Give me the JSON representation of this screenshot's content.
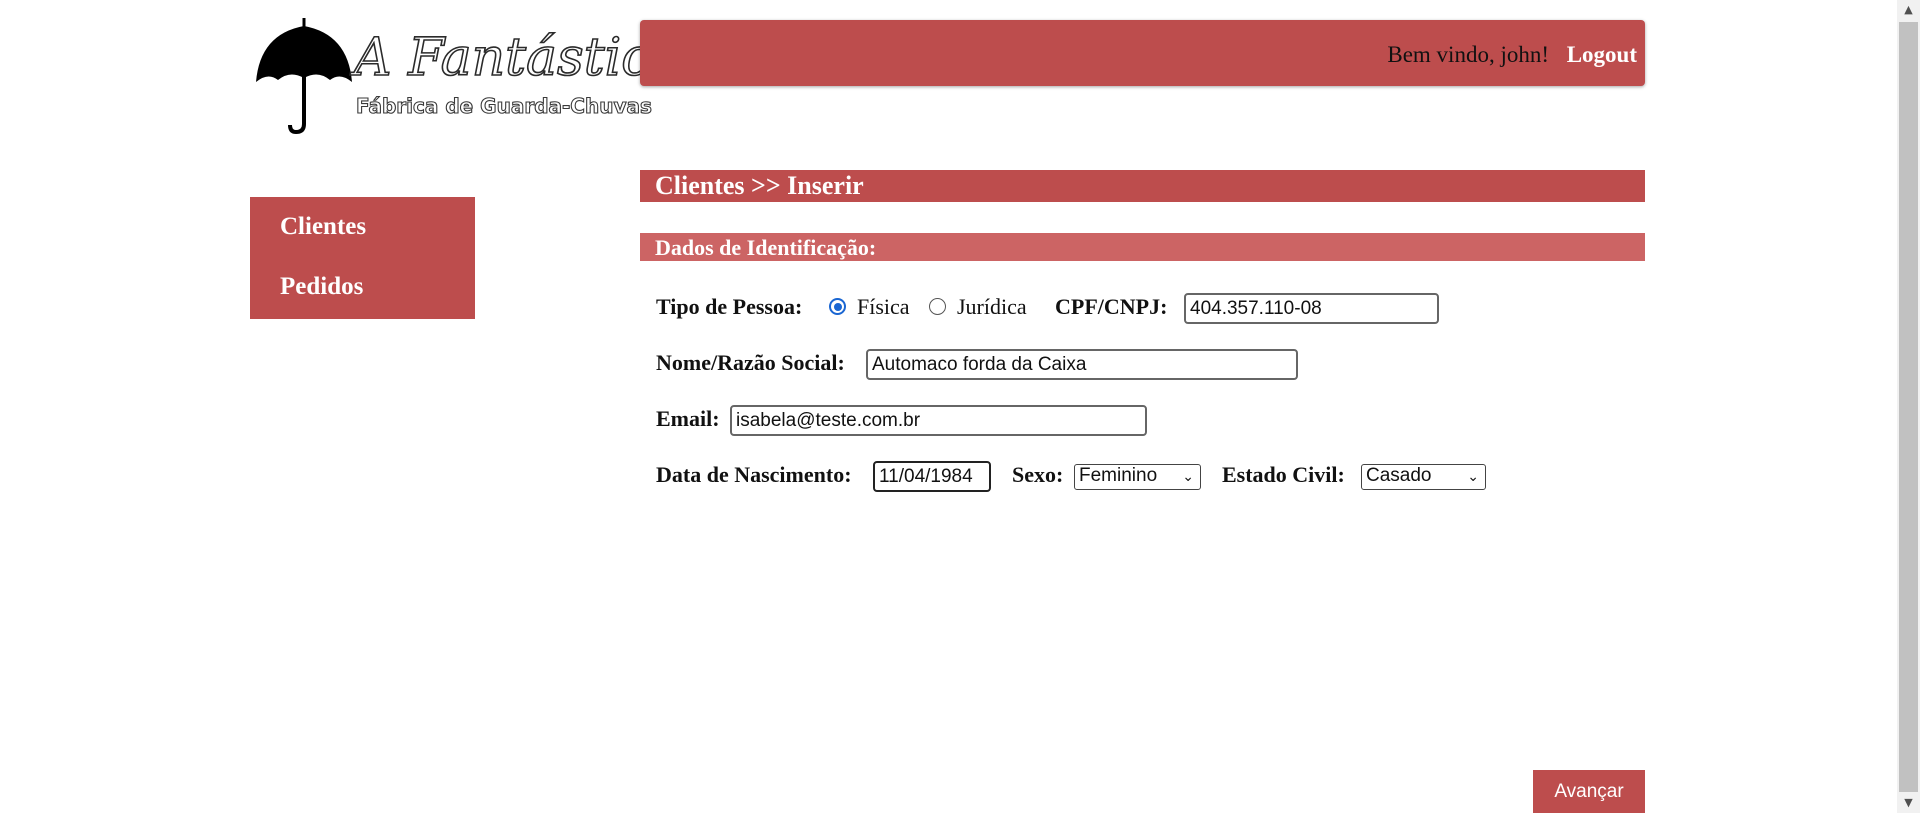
{
  "logo": {
    "title": "A Fantástica",
    "subtitle": "Fábrica de Guarda-Chuvas",
    "icon": "umbrella-icon"
  },
  "header": {
    "welcome_text": "Bem vindo, john!",
    "logout_label": "Logout"
  },
  "sidebar": {
    "items": [
      {
        "label": "Clientes"
      },
      {
        "label": "Pedidos"
      }
    ]
  },
  "page": {
    "title": "Clientes >> Inserir",
    "section_title": "Dados de Identificação:"
  },
  "form": {
    "tipo_pessoa_label": "Tipo de Pessoa:",
    "tipo_options": [
      {
        "label": "Física",
        "checked": true
      },
      {
        "label": "Jurídica",
        "checked": false
      }
    ],
    "cpf_label": "CPF/CNPJ:",
    "cpf_value": "404.357.110-08",
    "nome_label": "Nome/Razão Social:",
    "nome_value": "Automaco forda da Caixa",
    "email_label": "Email:",
    "email_value": "isabela@teste.com.br",
    "nascimento_label": "Data de Nascimento:",
    "nascimento_value": "11/04/1984",
    "sexo_label": "Sexo:",
    "sexo_value": "Feminino",
    "estado_civil_label": "Estado Civil:",
    "estado_civil_value": "Casado"
  },
  "actions": {
    "advance_label": "Avançar"
  },
  "colors": {
    "accent": "#bd4d4d",
    "section": "#cc6464",
    "radio": "#1a66d2"
  }
}
